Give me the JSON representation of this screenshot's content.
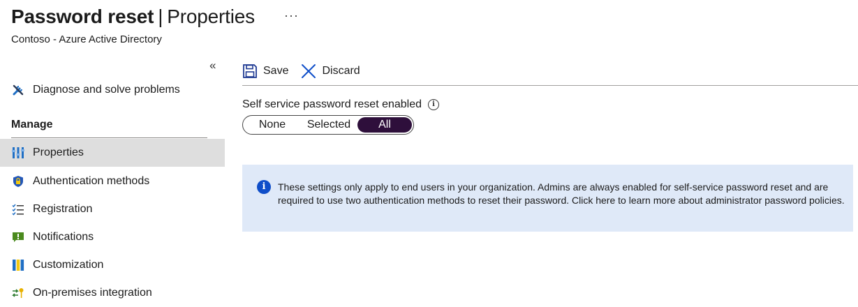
{
  "header": {
    "title_main": "Password reset",
    "title_sep": "|",
    "title_sub": "Properties",
    "more": "···",
    "subtitle": "Contoso - Azure Active Directory"
  },
  "sidebar": {
    "collapse": "«",
    "top_item": {
      "label": "Diagnose and solve problems",
      "icon": "wrench-screwdriver-icon"
    },
    "section_title": "Manage",
    "items": [
      {
        "label": "Properties",
        "icon": "properties-icon",
        "active": true
      },
      {
        "label": "Authentication methods",
        "icon": "shield-lock-icon"
      },
      {
        "label": "Registration",
        "icon": "checklist-icon"
      },
      {
        "label": "Notifications",
        "icon": "notification-icon"
      },
      {
        "label": "Customization",
        "icon": "customization-icon"
      },
      {
        "label": "On-premises integration",
        "icon": "sync-key-icon"
      }
    ]
  },
  "toolbar": {
    "save_label": "Save",
    "discard_label": "Discard"
  },
  "field": {
    "label": "Self service password reset enabled",
    "info": "i",
    "options": [
      "None",
      "Selected",
      "All"
    ],
    "selected": "All"
  },
  "banner": {
    "icon": "i",
    "text": "These settings only apply to end users in your organization. Admins are always enabled for self-service password reset and are required to use two authentication methods to reset their password. Click here to learn more about administrator password policies."
  },
  "colors": {
    "accent_dark": "#2e0f3b",
    "active_nav_bg": "#dedede",
    "banner_bg": "#dfe9f8",
    "info_blue": "#0f4ec9",
    "save_icon": "#1f3a93",
    "discard_icon": "#0f4ec9"
  }
}
